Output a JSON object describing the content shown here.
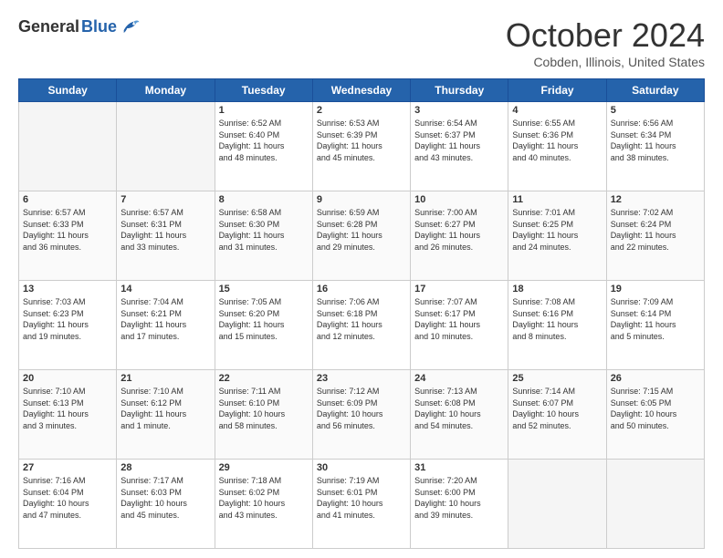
{
  "header": {
    "logo_general": "General",
    "logo_blue": "Blue",
    "month": "October 2024",
    "location": "Cobden, Illinois, United States"
  },
  "days_of_week": [
    "Sunday",
    "Monday",
    "Tuesday",
    "Wednesday",
    "Thursday",
    "Friday",
    "Saturday"
  ],
  "weeks": [
    [
      {
        "day": "",
        "content": ""
      },
      {
        "day": "",
        "content": ""
      },
      {
        "day": "1",
        "content": "Sunrise: 6:52 AM\nSunset: 6:40 PM\nDaylight: 11 hours\nand 48 minutes."
      },
      {
        "day": "2",
        "content": "Sunrise: 6:53 AM\nSunset: 6:39 PM\nDaylight: 11 hours\nand 45 minutes."
      },
      {
        "day": "3",
        "content": "Sunrise: 6:54 AM\nSunset: 6:37 PM\nDaylight: 11 hours\nand 43 minutes."
      },
      {
        "day": "4",
        "content": "Sunrise: 6:55 AM\nSunset: 6:36 PM\nDaylight: 11 hours\nand 40 minutes."
      },
      {
        "day": "5",
        "content": "Sunrise: 6:56 AM\nSunset: 6:34 PM\nDaylight: 11 hours\nand 38 minutes."
      }
    ],
    [
      {
        "day": "6",
        "content": "Sunrise: 6:57 AM\nSunset: 6:33 PM\nDaylight: 11 hours\nand 36 minutes."
      },
      {
        "day": "7",
        "content": "Sunrise: 6:57 AM\nSunset: 6:31 PM\nDaylight: 11 hours\nand 33 minutes."
      },
      {
        "day": "8",
        "content": "Sunrise: 6:58 AM\nSunset: 6:30 PM\nDaylight: 11 hours\nand 31 minutes."
      },
      {
        "day": "9",
        "content": "Sunrise: 6:59 AM\nSunset: 6:28 PM\nDaylight: 11 hours\nand 29 minutes."
      },
      {
        "day": "10",
        "content": "Sunrise: 7:00 AM\nSunset: 6:27 PM\nDaylight: 11 hours\nand 26 minutes."
      },
      {
        "day": "11",
        "content": "Sunrise: 7:01 AM\nSunset: 6:25 PM\nDaylight: 11 hours\nand 24 minutes."
      },
      {
        "day": "12",
        "content": "Sunrise: 7:02 AM\nSunset: 6:24 PM\nDaylight: 11 hours\nand 22 minutes."
      }
    ],
    [
      {
        "day": "13",
        "content": "Sunrise: 7:03 AM\nSunset: 6:23 PM\nDaylight: 11 hours\nand 19 minutes."
      },
      {
        "day": "14",
        "content": "Sunrise: 7:04 AM\nSunset: 6:21 PM\nDaylight: 11 hours\nand 17 minutes."
      },
      {
        "day": "15",
        "content": "Sunrise: 7:05 AM\nSunset: 6:20 PM\nDaylight: 11 hours\nand 15 minutes."
      },
      {
        "day": "16",
        "content": "Sunrise: 7:06 AM\nSunset: 6:18 PM\nDaylight: 11 hours\nand 12 minutes."
      },
      {
        "day": "17",
        "content": "Sunrise: 7:07 AM\nSunset: 6:17 PM\nDaylight: 11 hours\nand 10 minutes."
      },
      {
        "day": "18",
        "content": "Sunrise: 7:08 AM\nSunset: 6:16 PM\nDaylight: 11 hours\nand 8 minutes."
      },
      {
        "day": "19",
        "content": "Sunrise: 7:09 AM\nSunset: 6:14 PM\nDaylight: 11 hours\nand 5 minutes."
      }
    ],
    [
      {
        "day": "20",
        "content": "Sunrise: 7:10 AM\nSunset: 6:13 PM\nDaylight: 11 hours\nand 3 minutes."
      },
      {
        "day": "21",
        "content": "Sunrise: 7:10 AM\nSunset: 6:12 PM\nDaylight: 11 hours\nand 1 minute."
      },
      {
        "day": "22",
        "content": "Sunrise: 7:11 AM\nSunset: 6:10 PM\nDaylight: 10 hours\nand 58 minutes."
      },
      {
        "day": "23",
        "content": "Sunrise: 7:12 AM\nSunset: 6:09 PM\nDaylight: 10 hours\nand 56 minutes."
      },
      {
        "day": "24",
        "content": "Sunrise: 7:13 AM\nSunset: 6:08 PM\nDaylight: 10 hours\nand 54 minutes."
      },
      {
        "day": "25",
        "content": "Sunrise: 7:14 AM\nSunset: 6:07 PM\nDaylight: 10 hours\nand 52 minutes."
      },
      {
        "day": "26",
        "content": "Sunrise: 7:15 AM\nSunset: 6:05 PM\nDaylight: 10 hours\nand 50 minutes."
      }
    ],
    [
      {
        "day": "27",
        "content": "Sunrise: 7:16 AM\nSunset: 6:04 PM\nDaylight: 10 hours\nand 47 minutes."
      },
      {
        "day": "28",
        "content": "Sunrise: 7:17 AM\nSunset: 6:03 PM\nDaylight: 10 hours\nand 45 minutes."
      },
      {
        "day": "29",
        "content": "Sunrise: 7:18 AM\nSunset: 6:02 PM\nDaylight: 10 hours\nand 43 minutes."
      },
      {
        "day": "30",
        "content": "Sunrise: 7:19 AM\nSunset: 6:01 PM\nDaylight: 10 hours\nand 41 minutes."
      },
      {
        "day": "31",
        "content": "Sunrise: 7:20 AM\nSunset: 6:00 PM\nDaylight: 10 hours\nand 39 minutes."
      },
      {
        "day": "",
        "content": ""
      },
      {
        "day": "",
        "content": ""
      }
    ]
  ]
}
